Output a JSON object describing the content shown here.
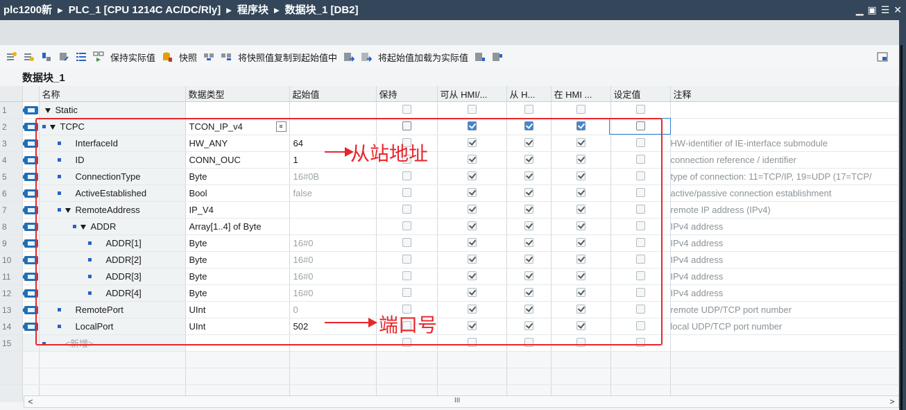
{
  "title": {
    "project": "plc1200新",
    "device": "PLC_1 [CPU 1214C AC/DC/Rly]",
    "folder": "程序块",
    "block": "数据块_1 [DB2]"
  },
  "toolbar": {
    "keep_actual": "保持实际值",
    "snapshot": "快照",
    "copy_snapshot": "将快照值复制到起始值中",
    "load_start": "将起始值加载为实际值"
  },
  "db_name": "数据块_1",
  "columns": [
    "名称",
    "数据类型",
    "起始值",
    "保持",
    "可从 HMI/...",
    "从 H...",
    "在 HMI ...",
    "设定值",
    "注释"
  ],
  "rows": [
    {
      "n": "1",
      "name": "Static",
      "type": "",
      "start": "",
      "comment": "",
      "retain": false,
      "h1": false,
      "h2": false,
      "h3": false,
      "sp": false
    },
    {
      "n": "2",
      "name": "TCPC",
      "type": "TCON_IP_v4",
      "start": "",
      "comment": "",
      "retain": false,
      "h1": true,
      "h2": true,
      "h3": true,
      "sp": false
    },
    {
      "n": "3",
      "name": "InterfaceId",
      "type": "HW_ANY",
      "start": "64",
      "comment": "HW-identifier of IE-interface submodule",
      "retain": false,
      "h1": true,
      "h2": true,
      "h3": true,
      "sp": false
    },
    {
      "n": "4",
      "name": "ID",
      "type": "CONN_OUC",
      "start": "1",
      "comment": "connection reference / identifier",
      "retain": false,
      "h1": true,
      "h2": true,
      "h3": true,
      "sp": false
    },
    {
      "n": "5",
      "name": "ConnectionType",
      "type": "Byte",
      "start": "16#0B",
      "comment": "type of connection: 11=TCP/IP, 19=UDP (17=TCP/",
      "retain": false,
      "h1": true,
      "h2": true,
      "h3": true,
      "sp": false
    },
    {
      "n": "6",
      "name": "ActiveEstablished",
      "type": "Bool",
      "start": "false",
      "comment": "active/passive connection establishment",
      "retain": false,
      "h1": true,
      "h2": true,
      "h3": true,
      "sp": false
    },
    {
      "n": "7",
      "name": "RemoteAddress",
      "type": "IP_V4",
      "start": "",
      "comment": "remote IP address (IPv4)",
      "retain": false,
      "h1": true,
      "h2": true,
      "h3": true,
      "sp": false
    },
    {
      "n": "8",
      "name": "ADDR",
      "type": "Array[1..4] of Byte",
      "start": "",
      "comment": "IPv4 address",
      "retain": false,
      "h1": true,
      "h2": true,
      "h3": true,
      "sp": false
    },
    {
      "n": "9",
      "name": "ADDR[1]",
      "type": "Byte",
      "start": "16#0",
      "comment": "IPv4 address",
      "retain": false,
      "h1": true,
      "h2": true,
      "h3": true,
      "sp": false
    },
    {
      "n": "10",
      "name": "ADDR[2]",
      "type": "Byte",
      "start": "16#0",
      "comment": "IPv4 address",
      "retain": false,
      "h1": true,
      "h2": true,
      "h3": true,
      "sp": false
    },
    {
      "n": "11",
      "name": "ADDR[3]",
      "type": "Byte",
      "start": "16#0",
      "comment": "IPv4 address",
      "retain": false,
      "h1": true,
      "h2": true,
      "h3": true,
      "sp": false
    },
    {
      "n": "12",
      "name": "ADDR[4]",
      "type": "Byte",
      "start": "16#0",
      "comment": "IPv4 address",
      "retain": false,
      "h1": true,
      "h2": true,
      "h3": true,
      "sp": false
    },
    {
      "n": "13",
      "name": "RemotePort",
      "type": "UInt",
      "start": "0",
      "comment": "remote UDP/TCP port number",
      "retain": false,
      "h1": true,
      "h2": true,
      "h3": true,
      "sp": false
    },
    {
      "n": "14",
      "name": "LocalPort",
      "type": "UInt",
      "start": "502",
      "comment": "local UDP/TCP port number",
      "retain": false,
      "h1": true,
      "h2": true,
      "h3": true,
      "sp": false
    },
    {
      "n": "15",
      "name": "<新增>",
      "type": "",
      "start": "",
      "comment": "",
      "retain": false,
      "h1": false,
      "h2": false,
      "h3": false,
      "sp": false
    }
  ],
  "annotations": {
    "slave_address": "从站地址",
    "port_number": "端口号"
  },
  "scroll_thumb": "III"
}
